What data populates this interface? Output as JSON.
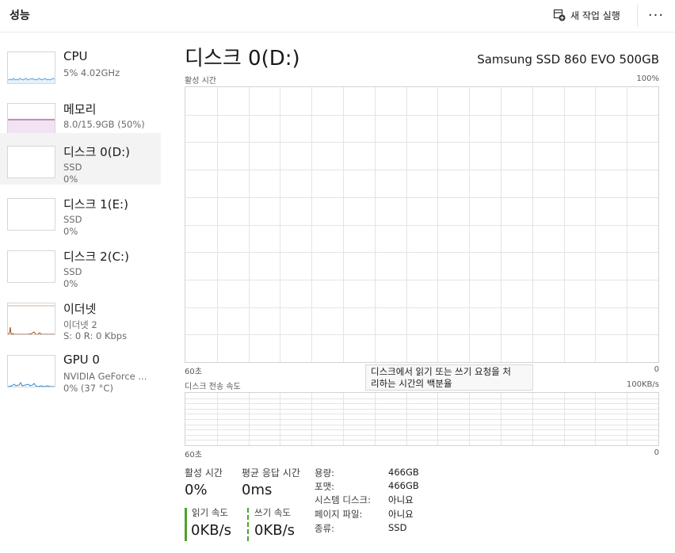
{
  "header": {
    "title": "성능",
    "run_new_task": "새 작업 실행",
    "more": "···"
  },
  "sidebar": {
    "items": [
      {
        "name": "CPU",
        "sub1": "5% 4.02GHz",
        "sub2": ""
      },
      {
        "name": "메모리",
        "sub1": "8.0/15.9GB (50%)",
        "sub2": ""
      },
      {
        "name": "디스크 0(D:)",
        "sub1": "SSD",
        "sub2": "0%"
      },
      {
        "name": "디스크 1(E:)",
        "sub1": "SSD",
        "sub2": "0%"
      },
      {
        "name": "디스크 2(C:)",
        "sub1": "SSD",
        "sub2": "0%"
      },
      {
        "name": "이더넷",
        "sub1": "이더넷 2",
        "sub2": "S: 0 R: 0 Kbps"
      },
      {
        "name": "GPU 0",
        "sub1": "NVIDIA GeForce ...",
        "sub2": "0% (37 °C)"
      }
    ],
    "selected_index": 2
  },
  "main": {
    "title": "디스크 0(D:)",
    "model": "Samsung SSD 860 EVO 500GB",
    "active_graph": {
      "label": "활성 시간",
      "max": "100%",
      "time_left": "60초",
      "min": "0",
      "value_percent": 0
    },
    "transfer_graph": {
      "label": "디스크 전송 속도",
      "max": "100KB/s",
      "time_left": "60초",
      "min": "0",
      "value": 0
    },
    "tooltip": {
      "line1": "디스크에서 읽기 또는 쓰기 요청을 처",
      "line2": "리하는 시간의 백분율"
    }
  },
  "stats": {
    "active_time": {
      "label": "활성 시간",
      "value": "0%"
    },
    "avg_response": {
      "label": "평균 응답 시간",
      "value": "0ms"
    },
    "read_speed": {
      "label": "읽기 속도",
      "value": "0KB/s"
    },
    "write_speed": {
      "label": "쓰기 속도",
      "value": "0KB/s"
    }
  },
  "info": [
    {
      "key": "용량:",
      "value": "466GB"
    },
    {
      "key": "포맷:",
      "value": "466GB"
    },
    {
      "key": "시스템 디스크:",
      "value": "아니요"
    },
    {
      "key": "페이지 파일:",
      "value": "아니요"
    },
    {
      "key": "종류:",
      "value": "SSD"
    }
  ],
  "colors": {
    "cpu_line": "#2a8ad4",
    "memory_line": "#8b2a8b",
    "ethernet_line": "#a0521d",
    "gpu_line": "#2a8ad4",
    "disk_accent": "#4da32a",
    "grid": "#e4e4e4"
  },
  "icons": {
    "run_new_task": "new-task-icon",
    "more": "more-horizontal-icon"
  }
}
